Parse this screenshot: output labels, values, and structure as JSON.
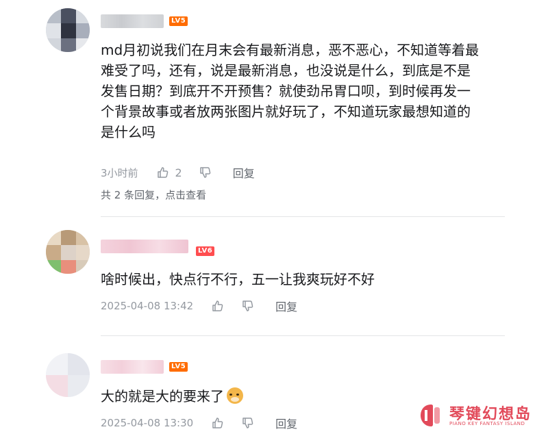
{
  "comments": [
    {
      "level": "LV5",
      "text_lines": [
        "md月初说我们在月末会有最新消息，恶不恶心，不知道等着最",
        "难受了吗，还有，说是最新消息，也没说是什么，到底是不是",
        "发售日期？到底开不开预售？就使劲吊胃口呗，到时候再发一",
        "个背景故事或者放两张图片就好玩了，不知道玩家最想知道的",
        "是什么吗"
      ],
      "time": "3小时前",
      "likes": "2",
      "reply_label": "回复",
      "sub_replies_count_text": "共 2 条回复，",
      "sub_replies_link": "点击查看",
      "icons": {
        "like": "thumbs-up-icon",
        "dislike": "thumbs-down-icon"
      }
    },
    {
      "level": "LV6",
      "text": "啥时候出，快点行不行，五一让我爽玩好不好",
      "time": "2025-04-08 13:42",
      "reply_label": "回复",
      "icons": {
        "like": "thumbs-up-icon",
        "dislike": "thumbs-down-icon"
      }
    },
    {
      "level": "LV5",
      "text": "大的就是大的要来了",
      "emoji": "doge-emoji",
      "time": "2025-04-08 13:30",
      "reply_label": "回复",
      "icons": {
        "like": "thumbs-up-icon",
        "dislike": "thumbs-down-icon"
      }
    }
  ],
  "watermark": {
    "title": "琴键幻想岛",
    "subtitle": "PIANO KEY FANTASY ISLAND"
  },
  "colors": {
    "level_orange": "#ff6c00",
    "level_red": "#ff4d4f",
    "meta_gray": "#9499a0",
    "watermark": "#e24a5a"
  }
}
